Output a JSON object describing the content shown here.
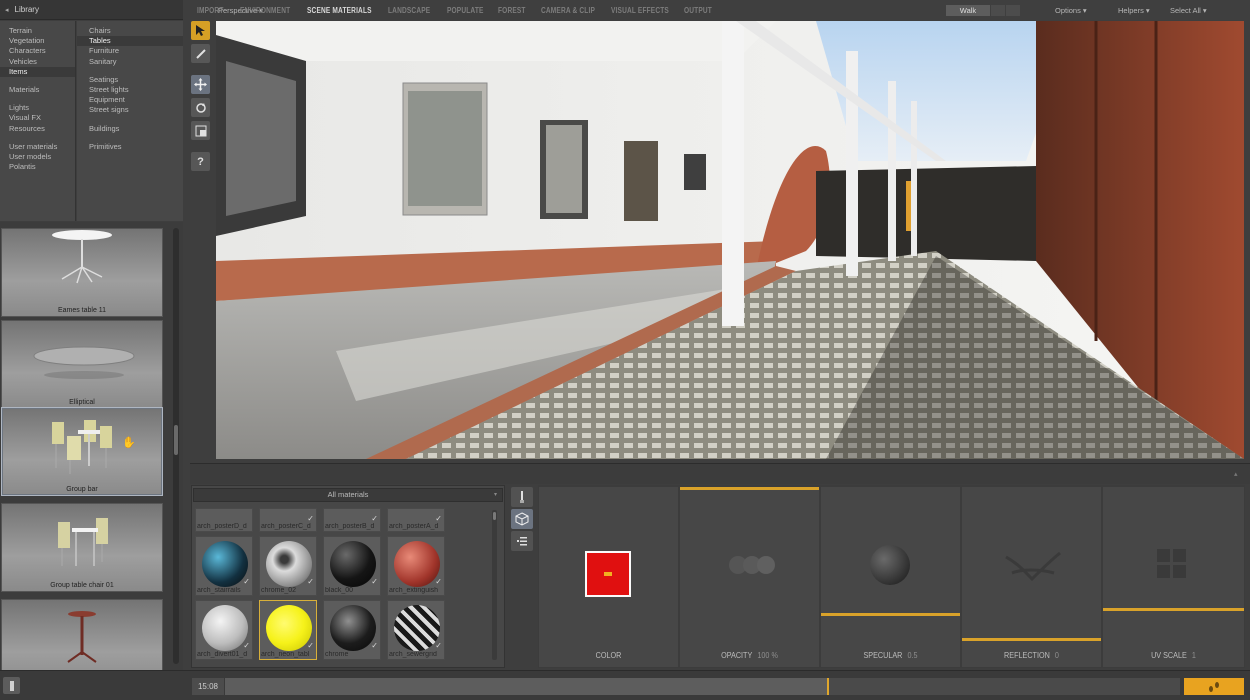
{
  "library": {
    "title": "Library",
    "categories": [
      {
        "label": "Terrain"
      },
      {
        "label": "Vegetation"
      },
      {
        "label": "Characters"
      },
      {
        "label": "Vehicles"
      },
      {
        "label": "Items"
      },
      {
        "label": "Materials"
      },
      {
        "label": "Lights"
      },
      {
        "label": "Visual FX"
      },
      {
        "label": "Resources"
      },
      {
        "label": "User materials"
      },
      {
        "label": "User models"
      },
      {
        "label": "Polantis"
      }
    ],
    "active_category": "Items",
    "subcategories": [
      {
        "label": "Chairs"
      },
      {
        "label": "Tables"
      },
      {
        "label": "Furniture"
      },
      {
        "label": "Sanitary"
      },
      {
        "label": "Seatings"
      },
      {
        "label": "Street lights"
      },
      {
        "label": "Equipment"
      },
      {
        "label": "Street signs"
      },
      {
        "label": "Buildings"
      },
      {
        "label": "Primitives"
      }
    ],
    "active_subcategory": "Tables",
    "items": [
      {
        "label": "Eames table 11"
      },
      {
        "label": "Elliptical"
      },
      {
        "label": "Group bar"
      },
      {
        "label": "Group table chair 01"
      },
      {
        "label": ""
      }
    ],
    "selected_item": "Group bar"
  },
  "viewport": {
    "view_mode": "Perspective ▾",
    "walk_label": "Walk",
    "options_label": "Options ▾",
    "helpers_label": "Helpers ▾",
    "select_all_label": "Select All ▾"
  },
  "tools": [
    {
      "icon": "cursor-icon"
    },
    {
      "icon": "paint-brush-icon"
    },
    {
      "icon": "move-icon"
    },
    {
      "icon": "rotate-icon"
    },
    {
      "icon": "scale-icon"
    },
    {
      "icon": "help-icon",
      "label": "?"
    }
  ],
  "tabs": [
    {
      "label": "IMPORT"
    },
    {
      "label": "ENVIRONMENT"
    },
    {
      "label": "SCENE MATERIALS"
    },
    {
      "label": "LANDSCAPE"
    },
    {
      "label": "POPULATE"
    },
    {
      "label": "FOREST"
    },
    {
      "label": "CAMERA & CLIP"
    },
    {
      "label": "VISUAL EFFECTS"
    },
    {
      "label": "OUTPUT"
    }
  ],
  "active_tab": "SCENE MATERIALS",
  "materials": {
    "filter": "All materials",
    "row0": [
      {
        "label": "arch_posterD_d"
      },
      {
        "label": "arch_posterC_d"
      },
      {
        "label": "arch_posterB_d"
      },
      {
        "label": "arch_posterA_d"
      }
    ],
    "row1": [
      {
        "label": "arch_stairrails"
      },
      {
        "label": "chrome_02"
      },
      {
        "label": "black_00"
      },
      {
        "label": "arch_extinguish"
      }
    ],
    "row2": [
      {
        "label": "arch_divert01_d"
      },
      {
        "label": "arch_neon_tabl"
      },
      {
        "label": "chrome"
      },
      {
        "label": "arch_sewergrid"
      }
    ],
    "selected": "arch_neon_tabl",
    "colors": {
      "color_swatch": "#e01010",
      "neon": "#f6f21a",
      "accent": "#d9a22a"
    }
  },
  "properties": [
    {
      "label": "COLOR",
      "value": ""
    },
    {
      "label": "OPACITY",
      "value": "100 %"
    },
    {
      "label": "SPECULAR",
      "value": "0.5"
    },
    {
      "label": "REFLECTION",
      "value": "0"
    },
    {
      "label": "UV SCALE",
      "value": "1"
    }
  ],
  "timeline": {
    "time": "15:08",
    "progress": 0.63
  }
}
